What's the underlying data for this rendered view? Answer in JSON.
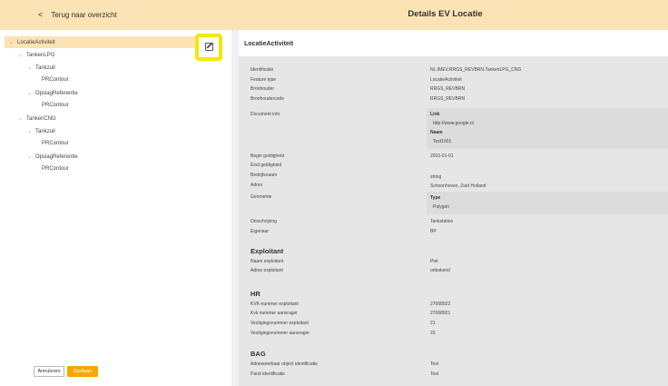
{
  "header": {
    "back_label": "Terug naar overzicht",
    "title": "Details EV Locatie"
  },
  "tree": {
    "items": [
      {
        "label": "LocatieActiviteit"
      },
      {
        "label": "TankenLPG"
      },
      {
        "label": "Tankzuil"
      },
      {
        "label": "PRContour"
      },
      {
        "label": "OpslagReferentie"
      },
      {
        "label": "PRContour"
      },
      {
        "label": "TankenCNG"
      },
      {
        "label": "Tankzuil"
      },
      {
        "label": "PRContour"
      },
      {
        "label": "OpslagReferentie"
      },
      {
        "label": "PRContour"
      }
    ]
  },
  "buttons": {
    "cancel": "Annuleren",
    "save": "Opslaan"
  },
  "detail": {
    "heading": "LocatieActiviteit",
    "rows": [
      {
        "label": "Identificatie",
        "value": "NL.IMEV.RRGS_REVBRN.TankenLPG_CNG"
      },
      {
        "label": "Feature type",
        "value": "LocatieActiviteit"
      },
      {
        "label": "Bronhouder",
        "value": "RRGS_REVBRN"
      },
      {
        "label": "Bronhoudercode",
        "value": "RRGS_REVBRN"
      },
      {
        "label": "Document info",
        "value": ""
      },
      {
        "label": "Begin geldigheid",
        "value": "2010-01-01"
      },
      {
        "label": "Eind geldigheid",
        "value": ""
      },
      {
        "label": "Bedrijfsnaam",
        "value": "string"
      },
      {
        "label": "Adres",
        "value": "Schoonhoven, Zuid Holland"
      },
      {
        "label": "Geometrie",
        "value": ""
      },
      {
        "label": "Omschrijving",
        "value": "Tankstation"
      },
      {
        "label": "Eigenaar",
        "value": "BP"
      }
    ],
    "document_info": {
      "link_label": "Link",
      "link_value": "http://www.google.nl",
      "naam_label": "Naam",
      "naam_value": "Test1001"
    },
    "geometrie": {
      "type_label": "Type",
      "type_value": "Polygon"
    },
    "exploitant": {
      "heading": "Exploitant",
      "rows": [
        {
          "label": "Naam exploitant",
          "value": "Piet"
        },
        {
          "label": "Adres exploitant",
          "value": "onbekend"
        }
      ]
    },
    "hr": {
      "heading": "HR",
      "rows": [
        {
          "label": "KVK-nummer exploitant",
          "value": "27068922"
        },
        {
          "label": "Kvk nummer aanvrager",
          "value": "27068921"
        },
        {
          "label": "Vestigingsnummer exploitant",
          "value": "21"
        },
        {
          "label": "Vestigingsnummer aanvrager",
          "value": "23"
        }
      ]
    },
    "bag": {
      "heading": "BAG",
      "rows": [
        {
          "label": "Adresseerbaar object identificatie",
          "value": "Test"
        },
        {
          "label": "Pand identificatie",
          "value": "Test"
        }
      ]
    }
  }
}
